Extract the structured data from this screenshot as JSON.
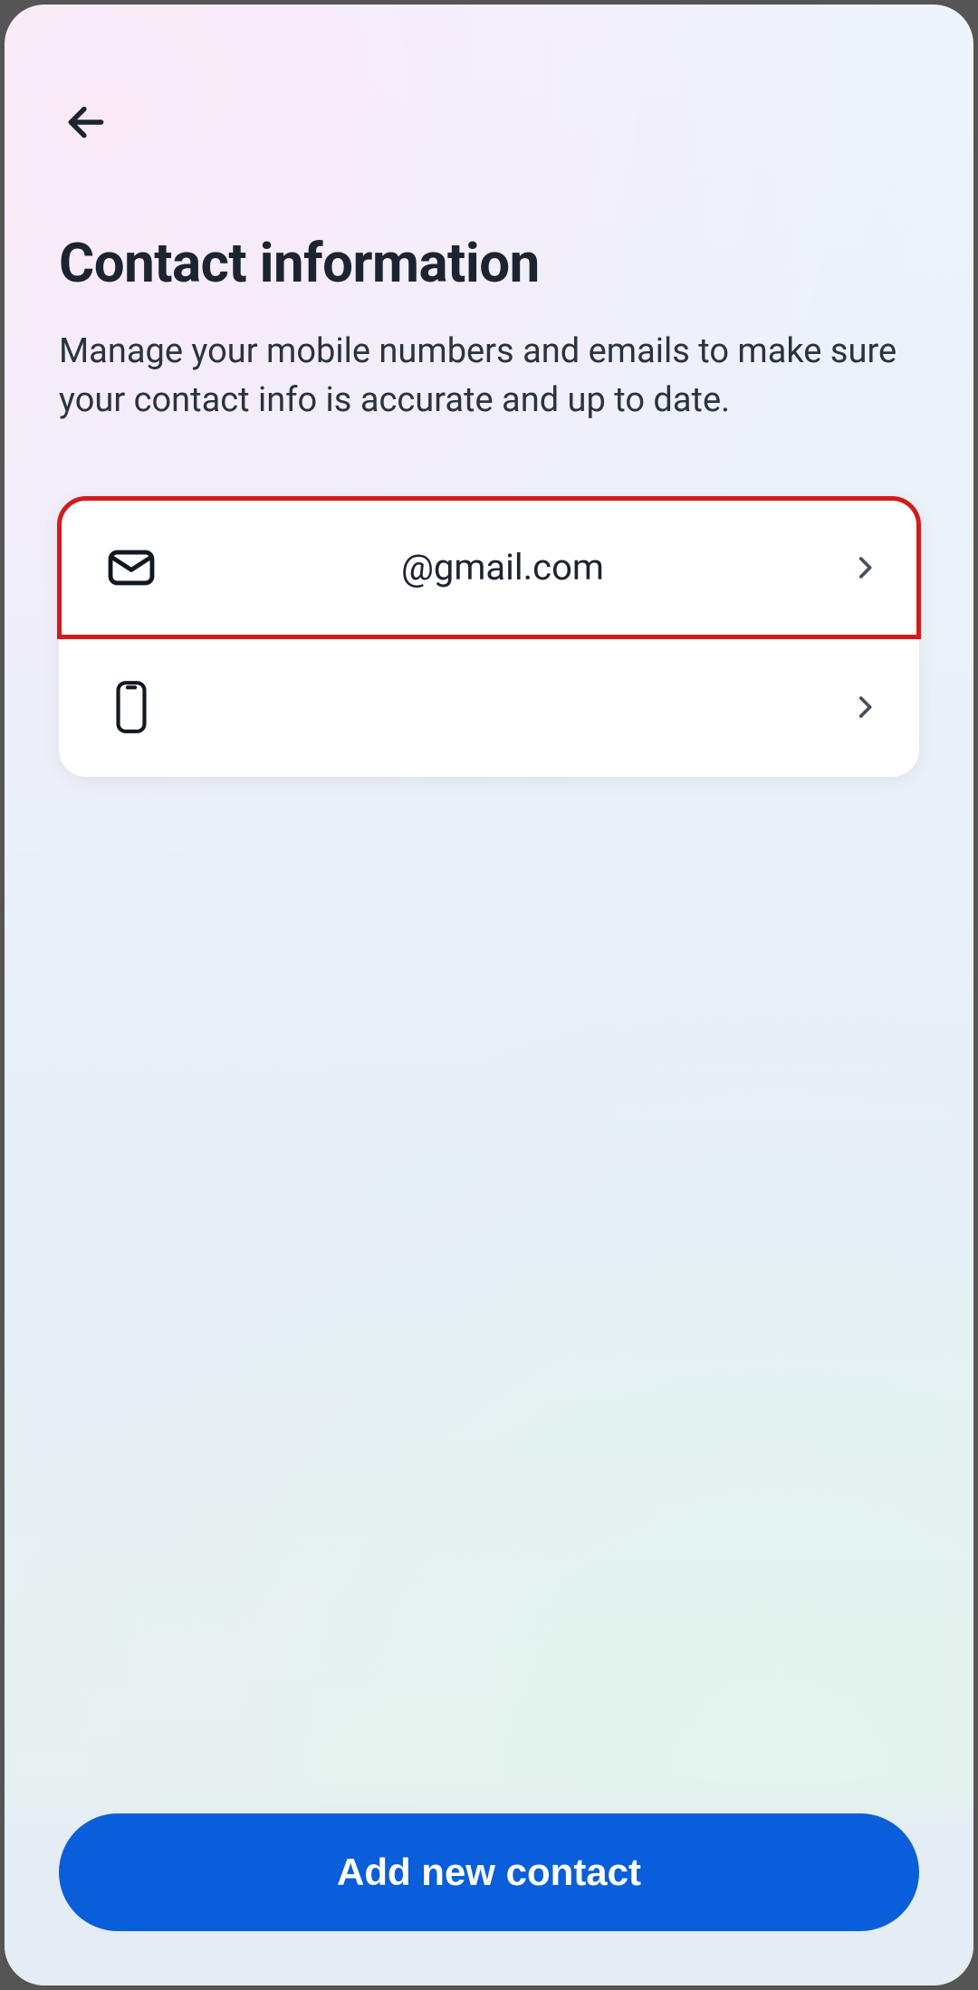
{
  "page": {
    "title": "Contact information",
    "subtitle": "Manage your mobile numbers and emails to make sure your contact info is accurate and up to date."
  },
  "contacts": [
    {
      "type": "email",
      "value": "@gmail.com",
      "highlighted": true
    },
    {
      "type": "phone",
      "value": "",
      "highlighted": false
    }
  ],
  "footer": {
    "primary_button_label": "Add new contact"
  },
  "colors": {
    "primary": "#0a5ed9",
    "highlight_border": "#d21c1c",
    "text": "#1b2430"
  }
}
